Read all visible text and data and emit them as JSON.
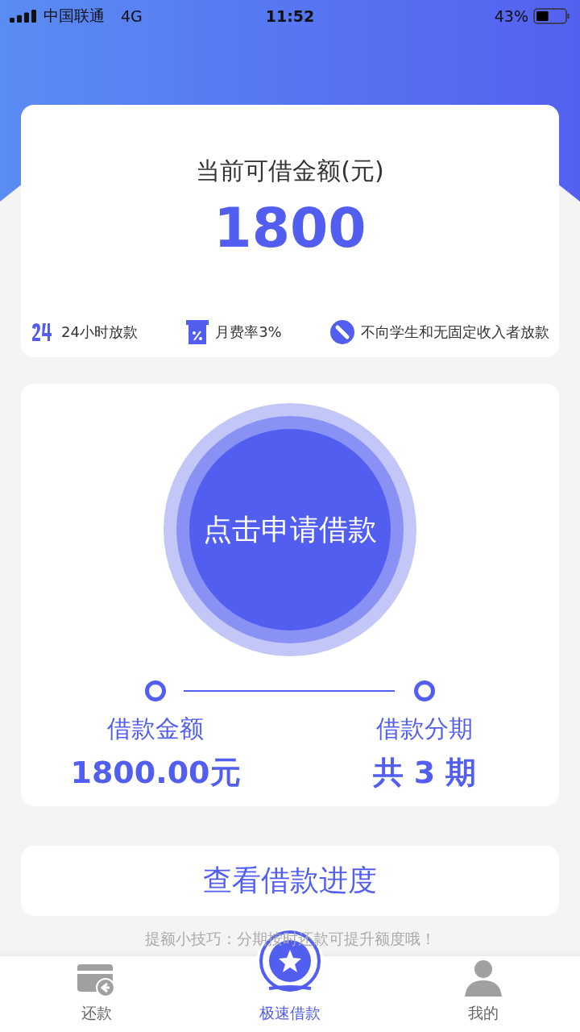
{
  "status_bar": {
    "carrier": "中国联通",
    "network": "4G",
    "time": "11:52",
    "battery": "43%"
  },
  "quota_card": {
    "label": "当前可借金额(元)",
    "amount": "1800",
    "features": [
      {
        "kind": "clock",
        "text": "24小时放款"
      },
      {
        "kind": "rate",
        "text": "月费率3%"
      },
      {
        "kind": "ban",
        "text": "不向学生和无固定收入者放款"
      }
    ]
  },
  "apply_card": {
    "button": "点击申请借款",
    "steps": [
      {
        "label": "借款金额",
        "value": "1800.00元"
      },
      {
        "label": "借款分期",
        "value": "共 3 期"
      }
    ]
  },
  "progress_button": "查看借款进度",
  "tip": "提额小技巧：分期按时还款可提升额度哦！",
  "tab_bar": [
    {
      "kind": "card",
      "label": "还款",
      "selected": false
    },
    {
      "kind": "star",
      "label": "极速借款",
      "selected": true
    },
    {
      "kind": "person",
      "label": "我的",
      "selected": false
    }
  ]
}
